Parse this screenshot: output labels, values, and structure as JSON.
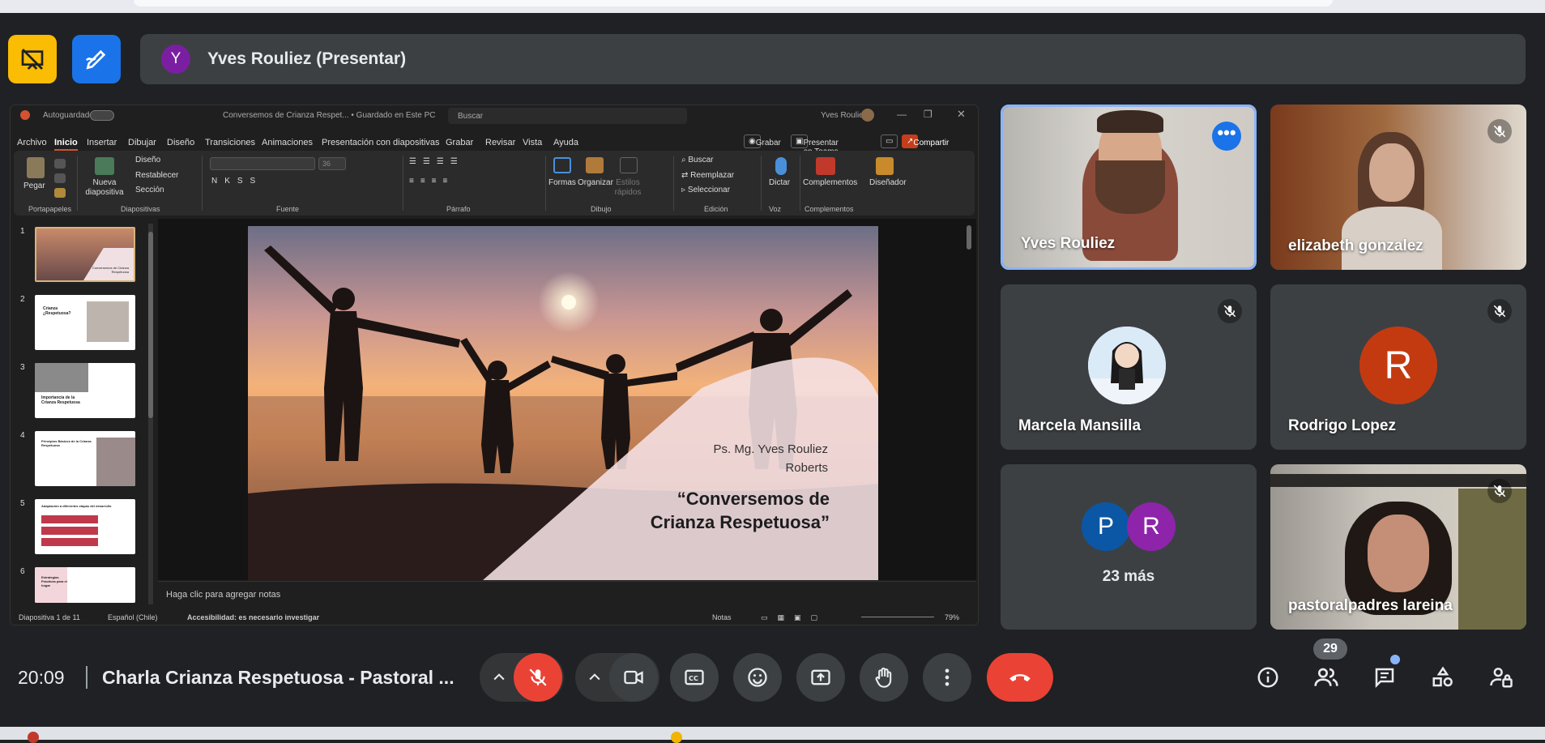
{
  "presenter": {
    "avatar_letter": "Y",
    "name": "Yves Rouliez (Presentar)"
  },
  "powerpoint": {
    "autosave": "Autoguardado",
    "doc_title": "Conversemos de Crianza Respet...  •  Guardado en Este PC",
    "search": "Buscar",
    "user": "Yves Rouliez",
    "menu": [
      "Archivo",
      "Inicio",
      "Insertar",
      "Dibujar",
      "Diseño",
      "Transiciones",
      "Animaciones",
      "Presentación con diapositivas",
      "Grabar",
      "Revisar",
      "Vista",
      "Ayuda"
    ],
    "record_btn": "Grabar",
    "teams_btn": "Presentar en Teams",
    "share_btn": "Compartir",
    "ribbon": {
      "pegar": "Pegar",
      "nueva": "Nueva diapositiva",
      "diseno": "Diseño",
      "restablecer": "Restablecer",
      "seccion": "Sección",
      "formas": "Formas",
      "organizar": "Organizar",
      "estilos": "Estilos rápidos",
      "buscar": "Buscar",
      "reemplazar": "Reemplazar",
      "seleccionar": "Seleccionar",
      "dictar": "Dictar",
      "complementos": "Complementos",
      "disenador": "Diseñador",
      "font_size": "36",
      "groups": [
        "Portapapeles",
        "Diapositivas",
        "Fuente",
        "Párrafo",
        "Dibujo",
        "Edición",
        "Voz",
        "Complementos"
      ]
    },
    "thumbs": [
      {
        "num": "1",
        "text": "Conversemos de Crianza Respetuosa"
      },
      {
        "num": "2",
        "text": "Crianza ¿Respetuosa?"
      },
      {
        "num": "3",
        "text": "Importancia de la Crianza Respetuosa"
      },
      {
        "num": "4",
        "text": "Principios Básicos de la Crianza Respetuosa"
      },
      {
        "num": "5",
        "text": "Adaptación a diferentes etapas del desarrollo"
      },
      {
        "num": "6",
        "text": "Estrategias Prácticas para el hogar"
      }
    ],
    "slide": {
      "author_line1": "Ps. Mg. Yves Rouliez",
      "author_line2": "Roberts",
      "title_line1": "“Conversemos de",
      "title_line2": "Crianza Respetuosa”"
    },
    "notes": "Haga clic para agregar notas",
    "status": {
      "slide": "Diapositiva 1 de 11",
      "lang": "Español (Chile)",
      "access": "Accesibilidad: es necesario investigar",
      "notes_btn": "Notas",
      "zoom": "79%"
    }
  },
  "participants": [
    {
      "name": "Yves Rouliez",
      "muted": false
    },
    {
      "name": "elizabeth gonzalez",
      "muted": true
    },
    {
      "name": "Marcela Mansilla",
      "muted": true
    },
    {
      "name": "Rodrigo Lopez",
      "muted": true,
      "letter": "R"
    },
    {
      "name": "23 más",
      "letters": [
        "P",
        "R"
      ]
    },
    {
      "name": "pastoralpadres lareina",
      "muted": true
    }
  ],
  "meeting": {
    "time": "20:09",
    "title": "Charla Crianza Respetuosa - Pastoral ...",
    "participant_count": "29"
  },
  "colors": {
    "danger": "#ea4335",
    "accent": "#8ab4f8",
    "tile": "#3c4043",
    "yellow_btn": "#fbbc04",
    "blue_btn": "#1a73e8"
  }
}
